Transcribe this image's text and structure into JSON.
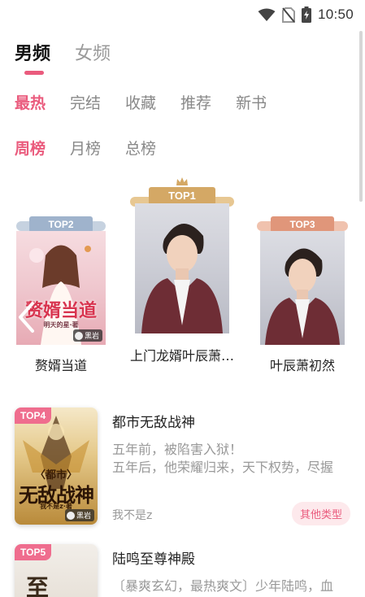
{
  "status_bar": {
    "time": "10:50",
    "icons": [
      "wifi-icon",
      "no-sim-icon",
      "battery-charging-icon"
    ]
  },
  "gender_tabs": [
    {
      "label": "男频",
      "active": true
    },
    {
      "label": "女频",
      "active": false
    }
  ],
  "category_tabs": [
    {
      "label": "最热",
      "active": true
    },
    {
      "label": "完结",
      "active": false
    },
    {
      "label": "收藏",
      "active": false
    },
    {
      "label": "推荐",
      "active": false
    },
    {
      "label": "新书",
      "active": false
    }
  ],
  "period_tabs": [
    {
      "label": "周榜",
      "active": true
    },
    {
      "label": "月榜",
      "active": false
    },
    {
      "label": "总榜",
      "active": false
    }
  ],
  "podium": [
    {
      "rank": "TOP1",
      "title": "上门龙婿叶辰萧…",
      "cover_style": "man",
      "color": "#d4a865"
    },
    {
      "rank": "TOP2",
      "title": "赘婿当道",
      "cover_style": "romance",
      "cover_text": "赘婿当道",
      "cover_sub": "明天的星·著",
      "cover_tag": "黑岩",
      "color": "#9fb3cc"
    },
    {
      "rank": "TOP3",
      "title": "叶辰萧初然",
      "cover_style": "man",
      "color": "#e0967a"
    }
  ],
  "list": [
    {
      "rank": "TOP4",
      "title": "都市无敌战神",
      "desc_lines": [
        "五年前，被陷害入狱！",
        "五年后，他荣耀归来，天下权势，尽握"
      ],
      "author": "我不是z",
      "tag": "其他类型",
      "cover_text_top": "〈都市〉",
      "cover_text": "无敌战神",
      "cover_sub": "我不是z·著",
      "cover_tag": "黑岩"
    },
    {
      "rank": "TOP5",
      "title": "陆鸣至尊神殿",
      "desc_lines": [
        "〔暴爽玄幻，最热爽文〕少年陆鸣，血"
      ],
      "cover_text": "至"
    }
  ],
  "colors": {
    "accent": "#ea5b7d",
    "top_badge": "#ef6d8e",
    "tag_bg": "#fde9ec"
  }
}
